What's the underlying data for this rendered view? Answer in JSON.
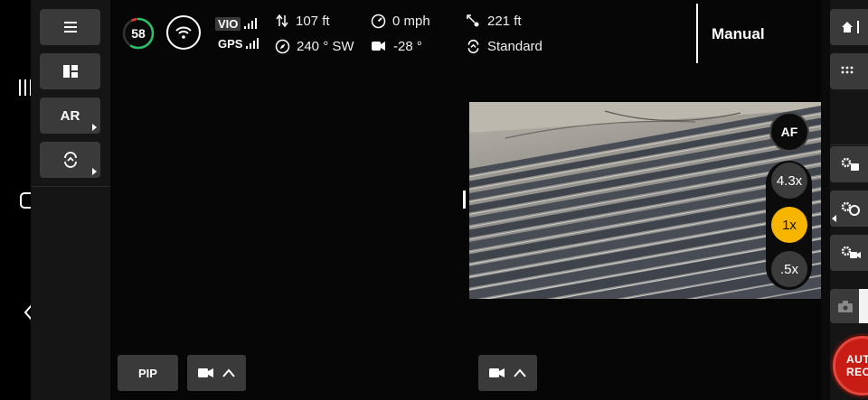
{
  "status": {
    "battery_percent": "58",
    "signals": [
      {
        "label": "VIO"
      },
      {
        "label": "GPS"
      }
    ]
  },
  "telemetry": {
    "vertical": "107 ft",
    "speed": "0 mph",
    "distance": "221 ft",
    "heading": "240 ° SW",
    "tilt": "-28 °",
    "flight_mode": "Standard"
  },
  "mode_label": "Manual",
  "left_panel": {
    "ar_label": "AR"
  },
  "camera": {
    "af_label": "AF",
    "zoom_levels": [
      "4.3x",
      "1x",
      ".5x"
    ],
    "active_zoom": "1x"
  },
  "bottom_bar": {
    "pip_label": "PIP"
  },
  "right_panel": {
    "rec_line1": "AUTO",
    "rec_line2": "REC"
  },
  "colors": {
    "accent": "#f7b500",
    "battery_ring": "#2bbf6a",
    "battery_ring_low": "#e03a2f",
    "record": "#c81d15"
  },
  "icons": [
    "menu-icon",
    "layout-icon",
    "flight-mode-icon",
    "wifi-icon",
    "altitude-icon",
    "speedometer-icon",
    "distance-icon",
    "compass-icon",
    "gimbal-tilt-icon",
    "camera-icon",
    "chevron-up-icon",
    "home-icon",
    "grid-icon",
    "camera-settings-icon"
  ]
}
